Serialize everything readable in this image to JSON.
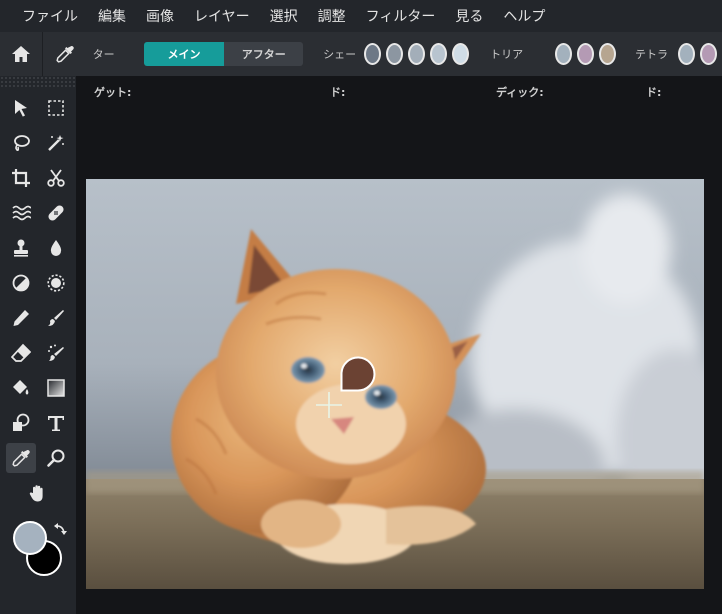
{
  "menu": [
    "ファイル",
    "編集",
    "画像",
    "レイヤー",
    "選択",
    "調整",
    "フィルター",
    "見る",
    "ヘルプ"
  ],
  "options": {
    "target_label": "ター",
    "main_label": "メイン",
    "after_label": "アフター",
    "shade_label": "シェー",
    "shade_swatches": [
      "#6d7886",
      "#8c96a1",
      "#a3aeb9",
      "#b8c4cf",
      "#d0dde7"
    ],
    "tria_label": "トリア",
    "tria_swatches": [
      "#a3b1bd",
      "#b49ab4",
      "#b6a590"
    ],
    "tetra_label": "テトラ",
    "tetra_swatches": [
      "#a3b1bd",
      "#b49ab4"
    ]
  },
  "info": {
    "target": "ゲット:",
    "col2": "ド:",
    "col3": "ディック:",
    "col4": "ド:"
  },
  "colors": {
    "foreground": "#a5b2bf",
    "background": "#000000",
    "picked": "#6b4233",
    "accent": "#169c9a"
  },
  "tools": [
    "move-tool",
    "marquee-tool",
    "lasso-tool",
    "magic-wand-tool",
    "crop-tool",
    "cut-tool",
    "liquify-tool",
    "healing-tool",
    "stamp-tool",
    "blur-drop-tool",
    "dodge-tool",
    "sponge-tool",
    "pencil-tool",
    "brush-tool",
    "eraser-tool",
    "color-replace-tool",
    "bucket-tool",
    "gradient-tool",
    "shape-tool",
    "text-tool",
    "eyedropper-tool",
    "zoom-tool",
    "hand-tool"
  ]
}
